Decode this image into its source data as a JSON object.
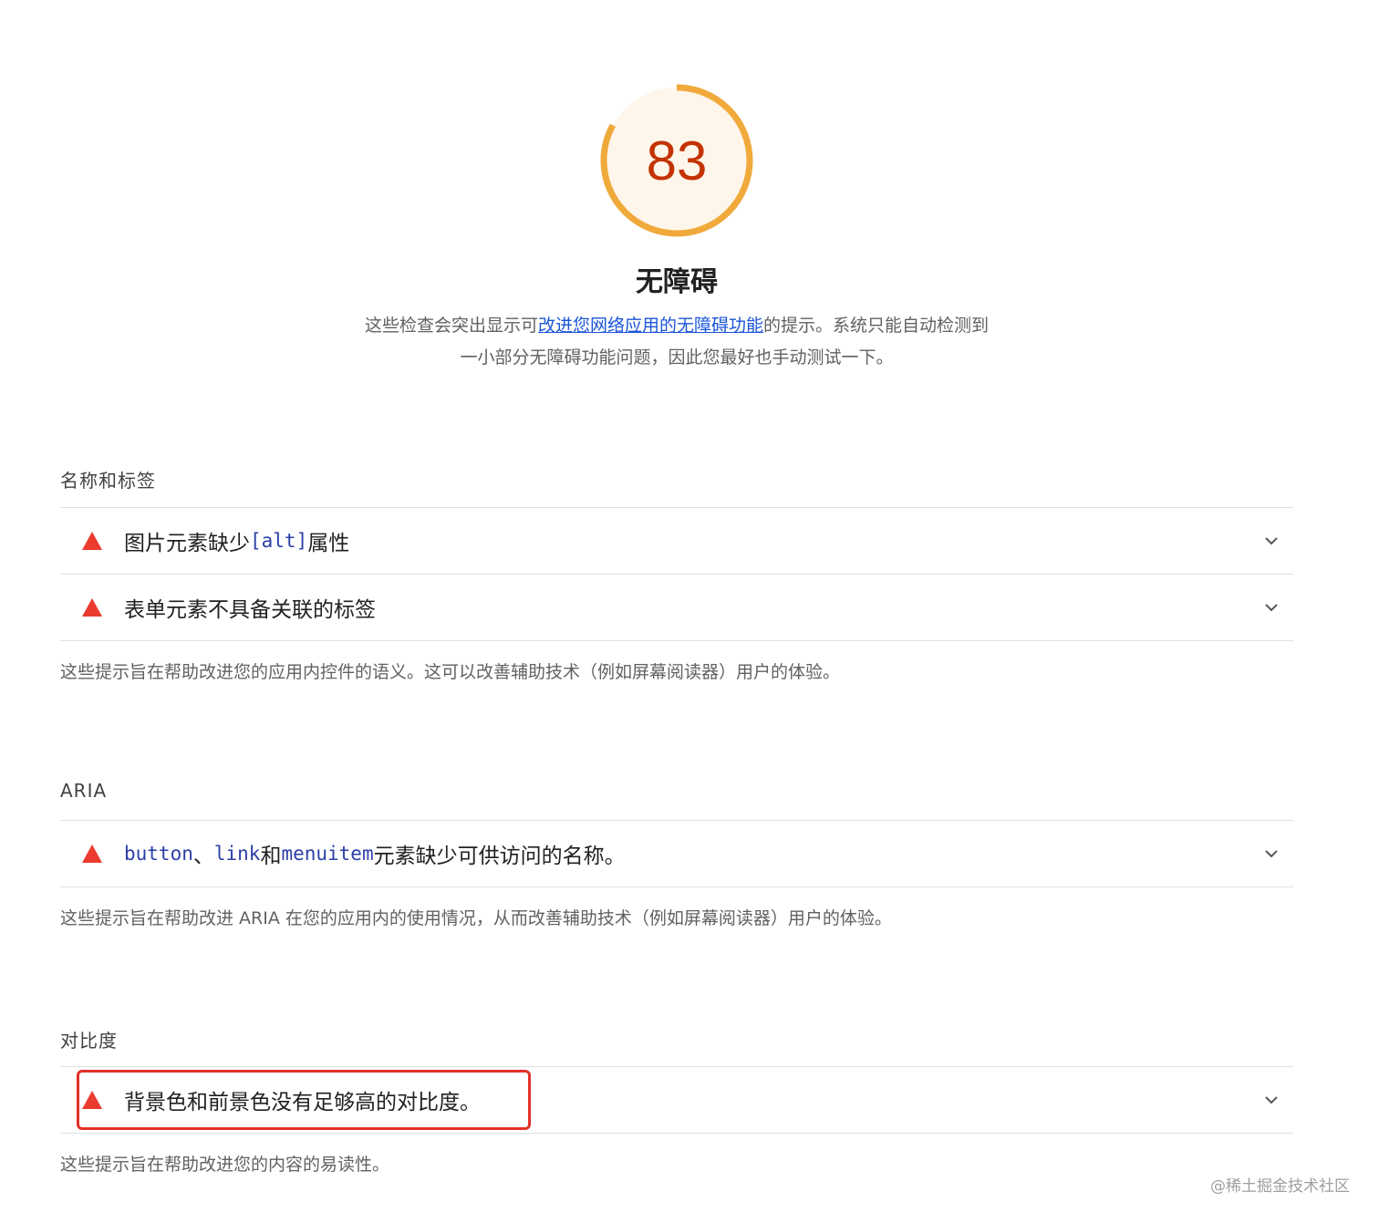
{
  "score": {
    "value": "83",
    "fraction": 0.83,
    "ring_color": "#f0a93b",
    "bg_color": "#fef6ea",
    "text_color": "#c33300"
  },
  "category": {
    "title": "无障碍",
    "desc_before": "这些检查会突出显示可",
    "desc_link": "改进您网络应用的无障碍功能",
    "desc_after": "的提示。系统只能自动检测到一小部分无障碍功能问题，因此您最好也手动测试一下。"
  },
  "groups": [
    {
      "title": "名称和标签",
      "audits": [
        {
          "t1": "图片元素缺少 ",
          "code1": "[alt]",
          "t2": " 属性"
        },
        {
          "t1": "表单元素不具备关联的标签"
        }
      ],
      "description": "这些提示旨在帮助改进您的应用内控件的语义。这可以改善辅助技术（例如屏幕阅读器）用户的体验。"
    },
    {
      "title": "ARIA",
      "audits": [
        {
          "code1": "button",
          "t1": "、",
          "code2": "link",
          "t2": " 和 ",
          "code3": "menuitem",
          "t3": " 元素缺少可供访问的名称。"
        }
      ],
      "description": "这些提示旨在帮助改进 ARIA 在您的应用内的使用情况，从而改善辅助技术（例如屏幕阅读器）用户的体验。"
    },
    {
      "title": "对比度",
      "audits": [
        {
          "t1": "背景色和前景色没有足够高的对比度。"
        }
      ],
      "description": "这些提示旨在帮助改进您的内容的易读性。"
    }
  ],
  "icons": {
    "fail": "red-triangle-icon",
    "expand": "chevron-down-icon"
  },
  "colors": {
    "fail": "#eb3b2f",
    "link": "#1a55d8",
    "code": "#2b3fa6",
    "highlight": "#e3312a"
  },
  "watermark": "@稀土掘金技术社区"
}
